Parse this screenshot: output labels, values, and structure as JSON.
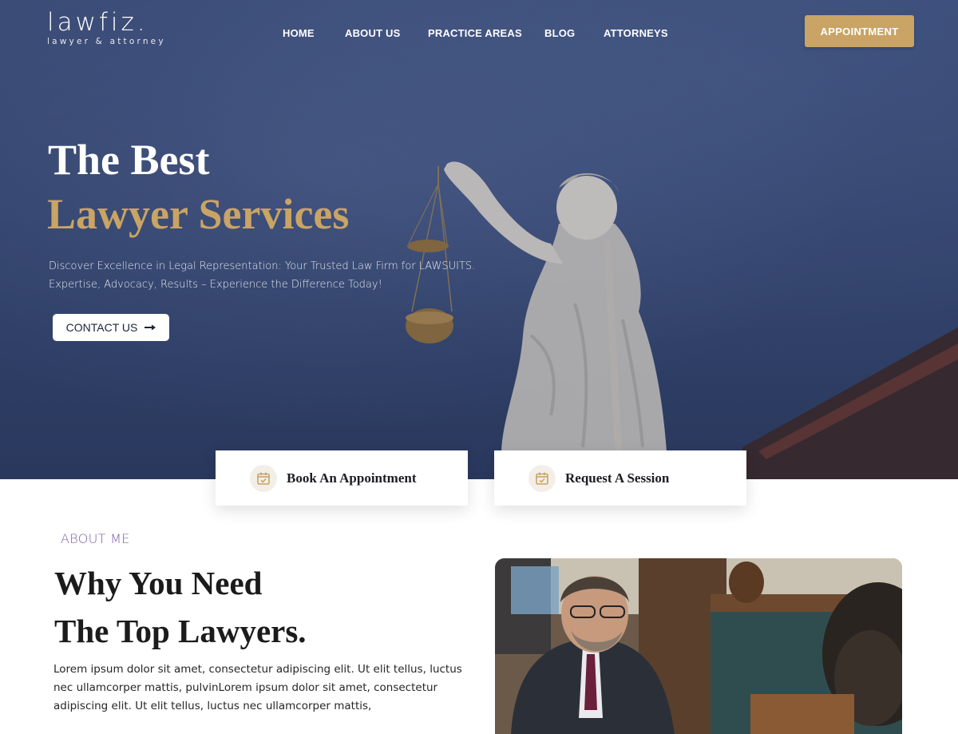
{
  "brand": {
    "name": "lawfiz.",
    "tagline": "lawyer & attorney"
  },
  "nav": {
    "items": [
      {
        "label": "HOME"
      },
      {
        "label": "ABOUT US"
      },
      {
        "label": "PRACTICE AREAS"
      },
      {
        "label": "BLOG"
      },
      {
        "label": "ATTORNEYS"
      }
    ],
    "cta_label": "APPOINTMENT"
  },
  "hero": {
    "title_line1": "The Best",
    "title_line2": "Lawyer Services",
    "description": "Discover Excellence in Legal Representation: Your Trusted Law Firm for LAWSUITS. Expertise, Advocacy, Results – Experience the Difference Today!",
    "contact_label": "CONTACT US",
    "contact_icon": "arrow-right-icon"
  },
  "cards": [
    {
      "label": "Book An Appointment",
      "icon": "calendar-check-icon"
    },
    {
      "label": "Request A Session",
      "icon": "calendar-check-icon"
    }
  ],
  "about": {
    "eyebrow": "ABOUT ME",
    "title_line1": "Why You Need",
    "title_line2": "The Top Lawyers.",
    "text": "Lorem ipsum dolor sit amet, consectetur adipiscing elit. Ut elit tellus, luctus nec ullamcorper mattis, pulvinLorem ipsum dolor sit amet, consectetur adipiscing elit. Ut elit tellus, luctus nec ullamcorper mattis,"
  },
  "colors": {
    "accent_gold": "#c9a464",
    "hero_navy": "#33456f",
    "eyebrow_purple": "#7b5fa6"
  }
}
